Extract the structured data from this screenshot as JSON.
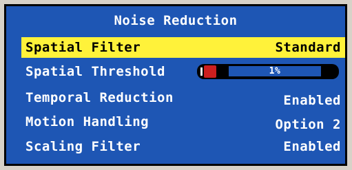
{
  "title": "Noise Reduction",
  "colors": {
    "panel": "#1e56b4",
    "highlight": "#fff23a",
    "slider_thumb": "#cc1f1f",
    "border": "#000000"
  },
  "rows": [
    {
      "label": "Spatial Filter",
      "value": "Standard",
      "selected": true
    },
    {
      "label": "Spatial Threshold",
      "value": "1%",
      "slider_percent": 1
    },
    {
      "label": "Temporal Reduction",
      "value": "Enabled"
    },
    {
      "label": "Motion Handling",
      "value": "Option 2"
    },
    {
      "label": "Scaling Filter",
      "value": "Enabled"
    }
  ]
}
